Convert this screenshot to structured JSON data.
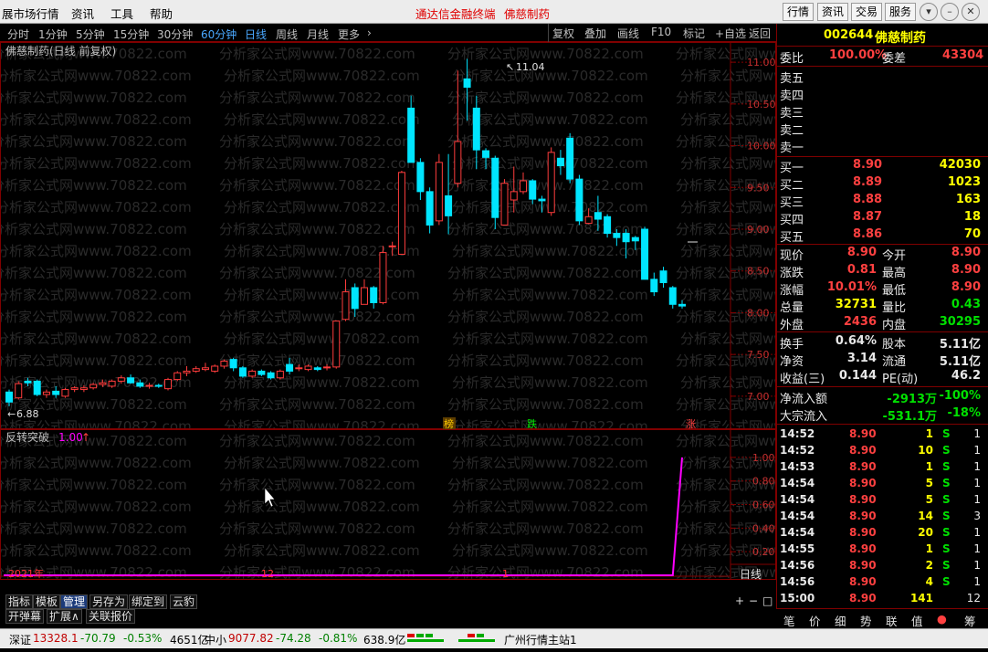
{
  "menubar": {
    "title": "展市场行情",
    "items": [
      "资讯",
      "工具",
      "帮助"
    ],
    "red_items": [
      "通达信金融终端",
      "佛慈制药"
    ],
    "buttons": [
      "行情",
      "资讯",
      "交易",
      "服务"
    ]
  },
  "periods": {
    "items": [
      "分时",
      "1分钟",
      "5分钟",
      "15分钟",
      "30分钟",
      "60分钟",
      "日线",
      "周线",
      "月线",
      "更多"
    ],
    "active": "日线",
    "tools": [
      "复权",
      "叠加",
      "画线",
      "F10",
      "标记",
      "+自选",
      "返回"
    ]
  },
  "chart": {
    "title": "佛慈制药(日线 前复权)",
    "high_label": "11.04",
    "low_label": "6.88",
    "ylabels": [
      "11.00",
      "10.50",
      "10.00",
      "9.50",
      "9.00",
      "8.50",
      "8.00",
      "7.50",
      "7.00"
    ],
    "markers": [
      "榜",
      "跌",
      "涨"
    ],
    "watermark": "分析家公式网www.70822.com"
  },
  "chart_data": [
    {
      "type": "candlestick",
      "title": "佛慈制药(日线 前复权)",
      "ylim": [
        6.8,
        11.4
      ],
      "y_ticks": [
        7.0,
        7.5,
        8.0,
        8.5,
        9.0,
        9.5,
        10.0,
        10.5,
        11.0
      ],
      "x_labels": [
        "2021年",
        "12",
        "1"
      ],
      "high": 11.04,
      "low": 6.88,
      "ohlc": [
        [
          7.05,
          7.08,
          6.88,
          6.93
        ],
        [
          6.98,
          7.18,
          6.96,
          7.15
        ],
        [
          7.18,
          7.22,
          7.12,
          7.16
        ],
        [
          7.18,
          7.2,
          7.0,
          7.02
        ],
        [
          7.02,
          7.08,
          6.98,
          7.05
        ],
        [
          7.06,
          7.12,
          6.98,
          7.02
        ],
        [
          7.0,
          7.1,
          6.98,
          7.08
        ],
        [
          7.08,
          7.12,
          7.05,
          7.1
        ],
        [
          7.08,
          7.13,
          7.05,
          7.1
        ],
        [
          7.1,
          7.16,
          7.08,
          7.14
        ],
        [
          7.14,
          7.2,
          7.11,
          7.16
        ],
        [
          7.12,
          7.2,
          7.1,
          7.18
        ],
        [
          7.18,
          7.25,
          7.15,
          7.22
        ],
        [
          7.22,
          7.26,
          7.15,
          7.16
        ],
        [
          7.16,
          7.2,
          7.1,
          7.12
        ],
        [
          7.12,
          7.16,
          7.09,
          7.13
        ],
        [
          7.13,
          7.15,
          7.1,
          7.12
        ],
        [
          7.09,
          7.22,
          7.07,
          7.2
        ],
        [
          7.2,
          7.3,
          7.18,
          7.28
        ],
        [
          7.28,
          7.36,
          7.24,
          7.3
        ],
        [
          7.3,
          7.36,
          7.28,
          7.33
        ],
        [
          7.32,
          7.4,
          7.3,
          7.34
        ],
        [
          7.3,
          7.38,
          7.28,
          7.36
        ],
        [
          7.36,
          7.44,
          7.33,
          7.42
        ],
        [
          7.44,
          7.46,
          7.3,
          7.34
        ],
        [
          7.34,
          7.36,
          7.22,
          7.24
        ],
        [
          7.24,
          7.32,
          7.22,
          7.3
        ],
        [
          7.3,
          7.32,
          7.24,
          7.26
        ],
        [
          7.28,
          7.3,
          7.2,
          7.22
        ],
        [
          7.22,
          7.32,
          7.2,
          7.3
        ],
        [
          7.38,
          7.46,
          7.26,
          7.3
        ],
        [
          7.34,
          7.38,
          7.3,
          7.34
        ],
        [
          7.32,
          7.38,
          7.3,
          7.36
        ],
        [
          7.34,
          7.36,
          7.3,
          7.32
        ],
        [
          7.34,
          7.38,
          7.31,
          7.35
        ],
        [
          7.35,
          7.9,
          7.33,
          7.9
        ],
        [
          7.92,
          8.4,
          7.9,
          8.25
        ],
        [
          8.3,
          8.35,
          7.95,
          8.05
        ],
        [
          8.1,
          8.4,
          8.1,
          8.3
        ],
        [
          8.3,
          8.32,
          8.05,
          8.12
        ],
        [
          8.12,
          8.8,
          8.1,
          8.72
        ],
        [
          8.8,
          8.85,
          8.68,
          8.8
        ],
        [
          8.7,
          9.7,
          8.7,
          9.68
        ],
        [
          10.45,
          10.6,
          9.8,
          9.8
        ],
        [
          9.8,
          9.85,
          9.35,
          9.45
        ],
        [
          9.45,
          9.5,
          8.95,
          9.05
        ],
        [
          9.1,
          9.9,
          9.05,
          9.8
        ],
        [
          9.4,
          9.9,
          8.94,
          9.16
        ],
        [
          9.55,
          10.9,
          9.5,
          10.05
        ],
        [
          10.8,
          11.04,
          10.3,
          10.7
        ],
        [
          10.45,
          10.6,
          9.72,
          9.95
        ],
        [
          9.94,
          9.97,
          9.72,
          9.86
        ],
        [
          9.85,
          9.88,
          9.0,
          9.14
        ],
        [
          9.05,
          9.6,
          9.05,
          9.55
        ],
        [
          9.35,
          9.75,
          9.2,
          9.45
        ],
        [
          9.45,
          9.68,
          9.42,
          9.58
        ],
        [
          9.58,
          9.6,
          9.3,
          9.36
        ],
        [
          9.36,
          9.4,
          9.2,
          9.34
        ],
        [
          9.2,
          9.98,
          9.16,
          9.92
        ],
        [
          9.85,
          9.95,
          9.65,
          9.76
        ],
        [
          10.09,
          10.15,
          9.55,
          9.6
        ],
        [
          9.6,
          9.65,
          9.05,
          9.1
        ],
        [
          9.07,
          9.25,
          9.06,
          9.15
        ],
        [
          9.2,
          9.4,
          8.98,
          9.12
        ],
        [
          9.15,
          9.18,
          8.9,
          8.95
        ],
        [
          8.95,
          9.0,
          8.8,
          8.9
        ],
        [
          8.95,
          9.0,
          8.65,
          8.85
        ],
        [
          8.9,
          8.92,
          8.75,
          8.86
        ],
        [
          9.0,
          9.03,
          8.4,
          8.4
        ],
        [
          8.4,
          8.48,
          8.2,
          8.25
        ],
        [
          8.5,
          8.55,
          8.3,
          8.36
        ],
        [
          8.3,
          8.32,
          8.05,
          8.1
        ],
        [
          8.1,
          8.15,
          8.05,
          8.08
        ]
      ]
    },
    {
      "type": "line",
      "title": "反转突破",
      "values_label": "1.00",
      "ylim": [
        0,
        1.1
      ],
      "y_ticks": [
        0.2,
        0.4,
        0.6,
        0.8,
        1.0
      ],
      "series": [
        {
          "values": [
            0,
            0,
            0,
            0,
            0,
            0,
            0,
            0,
            0,
            0,
            0,
            0,
            0,
            0,
            0,
            0,
            0,
            0,
            0,
            0,
            0,
            0,
            0,
            0,
            0,
            0,
            0,
            0,
            0,
            0,
            0,
            0,
            0,
            0,
            0,
            0,
            0,
            0,
            0,
            0,
            0,
            0,
            0,
            0,
            0,
            0,
            0,
            0,
            0,
            0,
            0,
            0,
            0,
            0,
            0,
            0,
            0,
            0,
            0,
            0,
            0,
            0,
            0,
            0,
            0,
            0,
            0,
            0,
            0,
            0,
            0,
            0,
            1
          ]
        }
      ]
    }
  ],
  "indicator": {
    "title": "反转突破",
    "value": "1.00",
    "ylabels": [
      "1.00",
      "0.80",
      "0.60",
      "0.40",
      "0.20"
    ],
    "xlabels": [
      "2021年",
      "12",
      "1"
    ],
    "period": "日线"
  },
  "bottomtabs": {
    "row1": [
      "指标",
      "模板",
      "管理",
      "另存为",
      "绑定到",
      "云豹"
    ],
    "row2": [
      "开弹幕",
      "扩展∧",
      "关联报价"
    ],
    "active": "管理",
    "pm": [
      "+",
      "−",
      "□"
    ]
  },
  "quote": {
    "code": "002644",
    "name": "佛慈制药",
    "weibi_label": "委比",
    "weibi": "100.00%",
    "weicha_label": "委差",
    "weicha": "43304",
    "sells": [
      {
        "l": "卖五"
      },
      {
        "l": "卖四"
      },
      {
        "l": "卖三"
      },
      {
        "l": "卖二"
      },
      {
        "l": "卖一"
      }
    ],
    "buys": [
      {
        "l": "买一",
        "p": "8.90",
        "v": "42030"
      },
      {
        "l": "买二",
        "p": "8.89",
        "v": "1023"
      },
      {
        "l": "买三",
        "p": "8.88",
        "v": "163"
      },
      {
        "l": "买四",
        "p": "8.87",
        "v": "18"
      },
      {
        "l": "买五",
        "p": "8.86",
        "v": "70"
      }
    ],
    "stats": [
      [
        "现价",
        "8.90",
        "今开",
        "8.90"
      ],
      [
        "涨跌",
        "0.81",
        "最高",
        "8.90"
      ],
      [
        "涨幅",
        "10.01%",
        "最低",
        "8.90"
      ],
      [
        "总量",
        "32731",
        "量比",
        "0.43"
      ],
      [
        "外盘",
        "2436",
        "内盘",
        "30295"
      ]
    ],
    "stats2": [
      [
        "换手",
        "0.64%",
        "股本",
        "5.11亿"
      ],
      [
        "净资",
        "3.14",
        "流通",
        "5.11亿"
      ],
      [
        "收益(三)",
        "0.144",
        "PE(动)",
        "46.2"
      ]
    ],
    "flow": [
      [
        "净流入额",
        "-2913万",
        "-100%"
      ],
      [
        "大宗流入",
        "-531.1万",
        "-18%"
      ]
    ],
    "ticks": [
      [
        "14:52",
        "8.90",
        "1",
        "S",
        "1"
      ],
      [
        "14:52",
        "8.90",
        "10",
        "S",
        "1"
      ],
      [
        "14:53",
        "8.90",
        "1",
        "S",
        "1"
      ],
      [
        "14:54",
        "8.90",
        "5",
        "S",
        "1"
      ],
      [
        "14:54",
        "8.90",
        "5",
        "S",
        "1"
      ],
      [
        "14:54",
        "8.90",
        "14",
        "S",
        "3"
      ],
      [
        "14:54",
        "8.90",
        "20",
        "S",
        "1"
      ],
      [
        "14:55",
        "8.90",
        "1",
        "S",
        "1"
      ],
      [
        "14:56",
        "8.90",
        "2",
        "S",
        "1"
      ],
      [
        "14:56",
        "8.90",
        "4",
        "S",
        "1"
      ],
      [
        "15:00",
        "8.90",
        "141",
        "",
        "12"
      ]
    ],
    "tabs": [
      "笔",
      "价",
      "细",
      "势",
      "联",
      "值",
      "主",
      "筹"
    ]
  },
  "status": {
    "sz_label": "深证",
    "sz": "13328.1",
    "sz_chg": "-70.79",
    "sz_pct": "-0.53%",
    "sz_amt": "4651亿",
    "zx_label": "中小",
    "zx": "9077.82",
    "zx_chg": "-74.28",
    "zx_pct": "-0.81%",
    "zx_amt": "638.9亿",
    "site": "广州行情主站1"
  },
  "colors": {
    "up": "#ff3c3c",
    "down": "#00e5ff",
    "frame": "#800000",
    "indicator": "#ff00ff",
    "bg": "#000000"
  }
}
